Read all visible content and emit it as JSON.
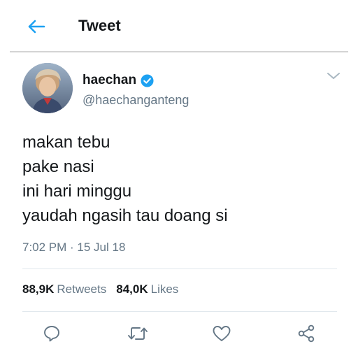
{
  "header": {
    "title": "Tweet",
    "back_icon": "arrow-left-icon"
  },
  "colors": {
    "accent": "#1da1f2",
    "text": "#14171a",
    "secondary": "#657786",
    "divider": "#e1e8ed"
  },
  "author": {
    "display_name": "haechan",
    "handle": "@haechanganteng",
    "verified": true,
    "avatar_icon": "profile-photo"
  },
  "tweet": {
    "lines": [
      "makan tebu",
      "pake nasi",
      "ini hari minggu",
      "yaudah ngasih tau doang si"
    ],
    "timestamp": "7:02 PM · 15 Jul 18"
  },
  "stats": {
    "retweets_count": "88,9K",
    "retweets_label": "Retweets",
    "likes_count": "84,0K",
    "likes_label": "Likes"
  },
  "actions": [
    "reply-icon",
    "retweet-icon",
    "like-icon",
    "share-icon"
  ]
}
